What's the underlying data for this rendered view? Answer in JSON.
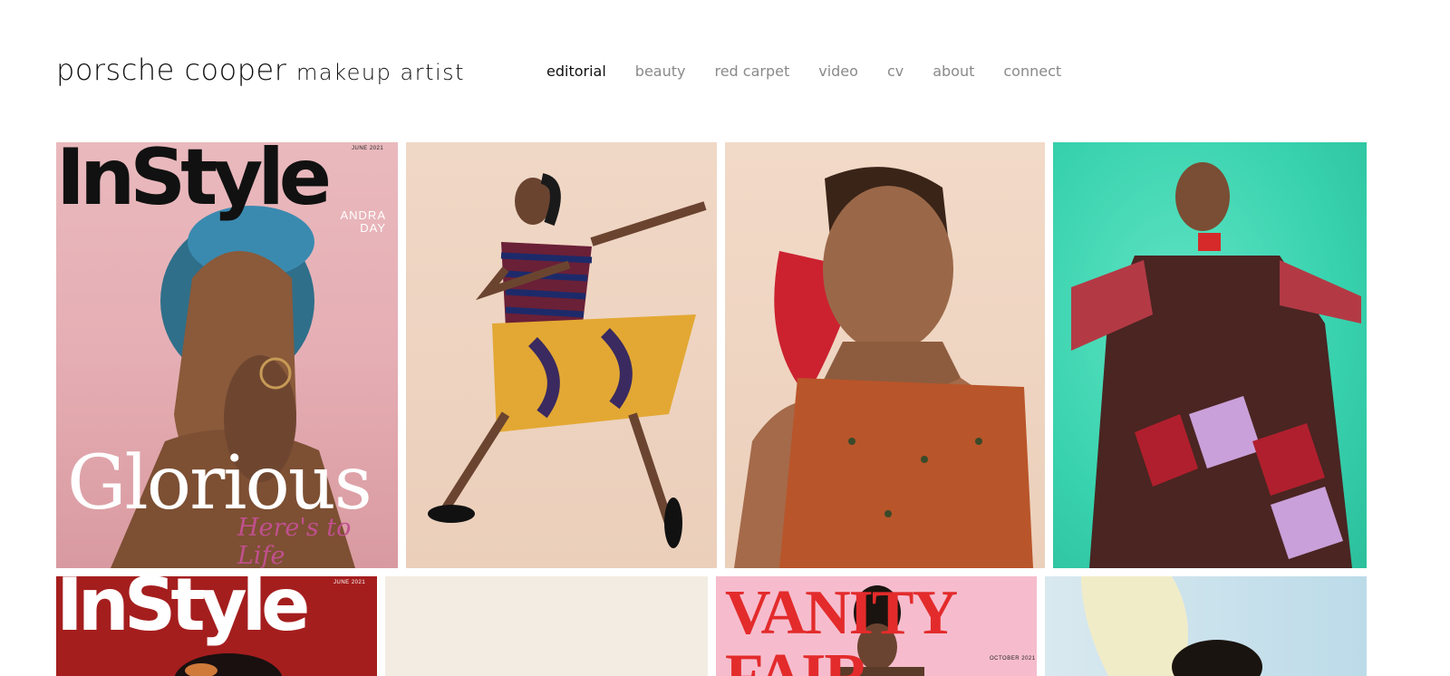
{
  "site": {
    "logo_main": "porsche cooper",
    "logo_sub": "makeup artist"
  },
  "nav": {
    "items": [
      {
        "label": "editorial",
        "active": true
      },
      {
        "label": "beauty",
        "active": false
      },
      {
        "label": "red carpet",
        "active": false
      },
      {
        "label": "video",
        "active": false
      },
      {
        "label": "cv",
        "active": false
      },
      {
        "label": "about",
        "active": false
      },
      {
        "label": "connect",
        "active": false
      }
    ]
  },
  "gallery": {
    "tile1": {
      "masthead": "InStyle",
      "issue": "JUNE 2021",
      "cover_name_1": "ANDRA",
      "cover_name_2": "DAY",
      "headline": "Glorious",
      "tagline": "Here's to Life"
    },
    "tile5": {
      "masthead": "InStyle",
      "issue": "JUNE 2021"
    },
    "tile7": {
      "masthead": "VANITY FAIR",
      "issue": "OCTOBER 2021"
    }
  },
  "colors": {
    "text_primary": "#111111",
    "nav_inactive": "#8a8a8a",
    "tile4_background": "#38d2ae",
    "tile5_background": "#a51e1e",
    "tile7_background": "#f6bccd",
    "vanity_fair_red": "#e32b2b"
  }
}
